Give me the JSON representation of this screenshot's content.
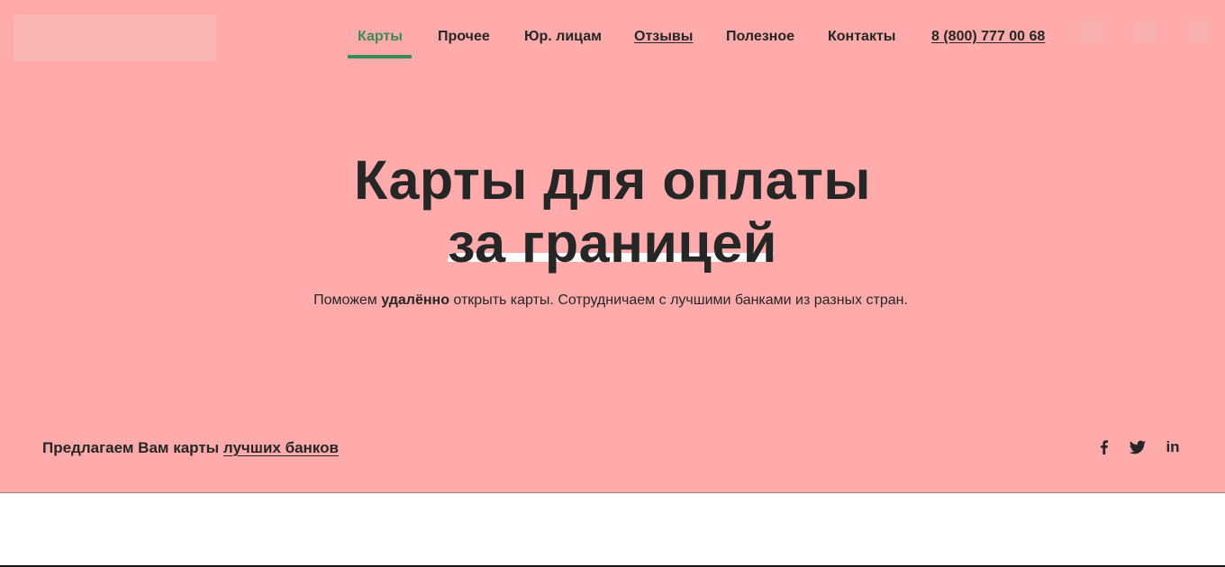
{
  "header": {
    "nav": [
      {
        "label": "Карты",
        "active": true
      },
      {
        "label": "Прочее"
      },
      {
        "label": "Юр. лицам"
      },
      {
        "label": "Отзывы"
      },
      {
        "label": "Полезное"
      },
      {
        "label": "Контакты"
      }
    ],
    "phone": "8 (800) 777 00 68"
  },
  "hero": {
    "title_line1": "Карты для оплаты",
    "title_line2": "за границей",
    "subtitle_before": "Поможем ",
    "subtitle_bold": "удалённо",
    "subtitle_after": " открыть карты. Сотрудничаем с лучшими банками из разных стран.",
    "offer_text": "Предлагаем Вам карты ",
    "offer_link": "лучших банков"
  },
  "social": {
    "icons": [
      "facebook-icon",
      "twitter-icon",
      "linkedin-icon"
    ],
    "linkedin_label": "in"
  },
  "colors": {
    "hero_background": "#ffabab",
    "accent_green": "#3b8a5a",
    "text": "#262626"
  }
}
